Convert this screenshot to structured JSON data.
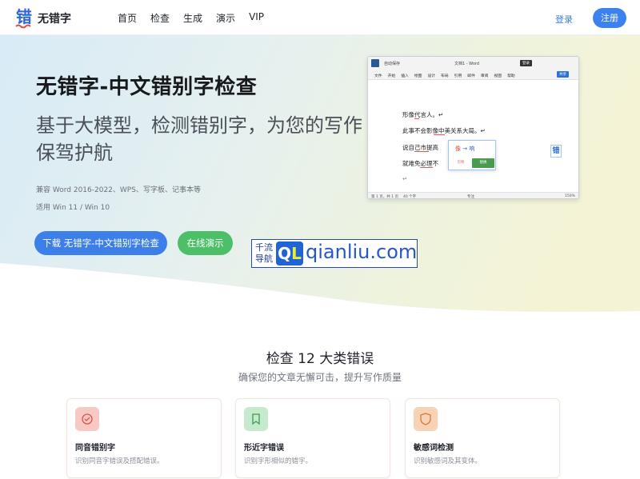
{
  "header": {
    "brand": "无错字",
    "nav": [
      "首页",
      "检查",
      "生成",
      "演示",
      "VIP"
    ],
    "login": "登录",
    "signup": "注册"
  },
  "hero": {
    "title": "无错字-中文错别字检查",
    "subtitle": "基于大模型，检测错别字，为您的写作保驾护航",
    "compat": "兼容 Word 2016-2022、WPS、写字板、记事本等",
    "os": "适用 Win 11 / Win 10",
    "download_btn": "下载 无错字-中文错别字检查",
    "demo_btn": "在线演示"
  },
  "watermark": {
    "left_top": "千流",
    "left_bottom": "导航",
    "ql": "QL",
    "domain": "qianliu.com"
  },
  "word_window": {
    "autosave": "自动保存",
    "doc_title": "文档1 - Word",
    "login_badge": "登录",
    "menu": [
      "文件",
      "开始",
      "插入",
      "绘图",
      "设计",
      "布局",
      "引用",
      "邮件",
      "审阅",
      "视图",
      "帮助"
    ],
    "share": "共享",
    "lines": [
      "形像代言人。↵",
      "此事不会影像中美关系大局。↵",
      "说自己市提高",
      "就难免必理不",
      "↵"
    ],
    "popup": {
      "old": "像",
      "arrow": "→",
      "new": "响",
      "ignore": "忽略",
      "replace": "替换"
    },
    "side_badge": "错",
    "status": {
      "page": "第 1 页，共 1 页",
      "words": "40 个字",
      "focus": "专注",
      "zoom": "150%"
    }
  },
  "section": {
    "title": "检查 12 大类错误",
    "subtitle": "确保您的文章无懈可击，提升写作质量"
  },
  "cards": [
    {
      "title": "同音错别字",
      "desc": "识别同音字错误及搭配错误。",
      "color": "#f4b8b2",
      "icon": "check-circle-icon"
    },
    {
      "title": "形近字错误",
      "desc": "识别字形相似的错字。",
      "color": "#bfe6c4",
      "icon": "bookmark-icon"
    },
    {
      "title": "敏感词检测",
      "desc": "识别敏感词及其变体。",
      "color": "#f6c9a6",
      "icon": "shield-icon"
    }
  ]
}
